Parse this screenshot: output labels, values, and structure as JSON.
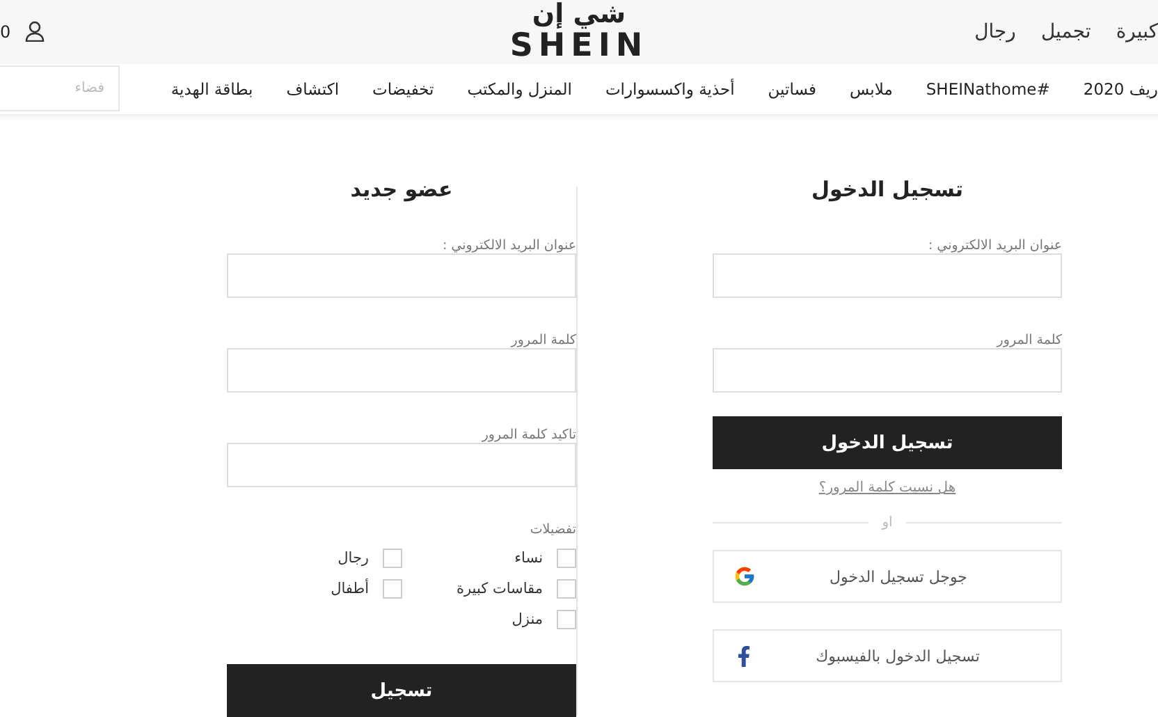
{
  "header": {
    "cart_count": "0",
    "logo_arabic": "شي إن",
    "logo_latin": "SHEIN",
    "links": [
      "كبيرة",
      "تجميل",
      "رجال"
    ]
  },
  "nav": {
    "items": [
      "ريف 2020",
      "#SHEINathome",
      "ملابس",
      "فساتين",
      "أحذية واكسسوارات",
      "المنزل والمكتب",
      "تخفيضات",
      "اكتشاف",
      "بطاقة الهدية"
    ],
    "search": {
      "placeholder": "فضاء"
    }
  },
  "login": {
    "title": "تسجيل الدخول",
    "fields": [
      {
        "label": "عنوان البريد الالكتروني :"
      },
      {
        "label": "كلمة المرور"
      }
    ],
    "submit": "تسجيل الدخول",
    "forgot": "هل نسيت كلمة المرور؟",
    "or": "او",
    "social": [
      {
        "kind": "google",
        "label": "جوجل تسجيل الدخول"
      },
      {
        "kind": "facebook",
        "label": "تسجيل الدخول بالفيسبوك"
      }
    ]
  },
  "register": {
    "title": "عضو جديد",
    "fields": [
      {
        "label": "عنوان البريد الالكتروني :"
      },
      {
        "label": "كلمة المرور"
      },
      {
        "label": "تاكيد كلمة المرور"
      }
    ],
    "preferences_label": "تفضيلات",
    "preferences": [
      {
        "label": "نساء",
        "checked": false
      },
      {
        "label": "رجال",
        "checked": false
      },
      {
        "label": "مقاسات كبيرة",
        "checked": false
      },
      {
        "label": "أطفال",
        "checked": false
      },
      {
        "label": "منزل",
        "checked": false
      }
    ],
    "submit": "تسجيل"
  }
}
